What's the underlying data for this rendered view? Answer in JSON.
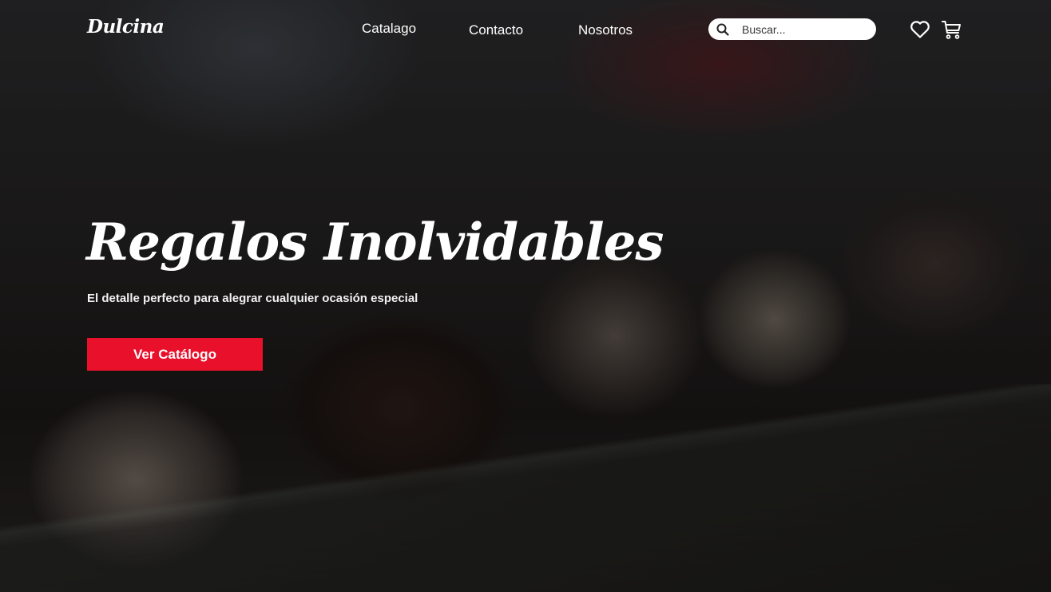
{
  "brand": {
    "logo_text": "Dulcina"
  },
  "nav": {
    "links": [
      {
        "label": "Catalago"
      },
      {
        "label": "Contacto"
      },
      {
        "label": "Nosotros"
      }
    ]
  },
  "search": {
    "placeholder": "Buscar..."
  },
  "icons": {
    "search": "search-icon",
    "favorites": "heart-icon",
    "cart": "cart-icon"
  },
  "hero": {
    "title": "Regalos Inolvidables",
    "subtitle": "El detalle perfecto para alegrar cualquier ocasión especial",
    "cta_label": "Ver Catálogo"
  },
  "colors": {
    "accent": "#e8102a",
    "text": "#ffffff"
  }
}
